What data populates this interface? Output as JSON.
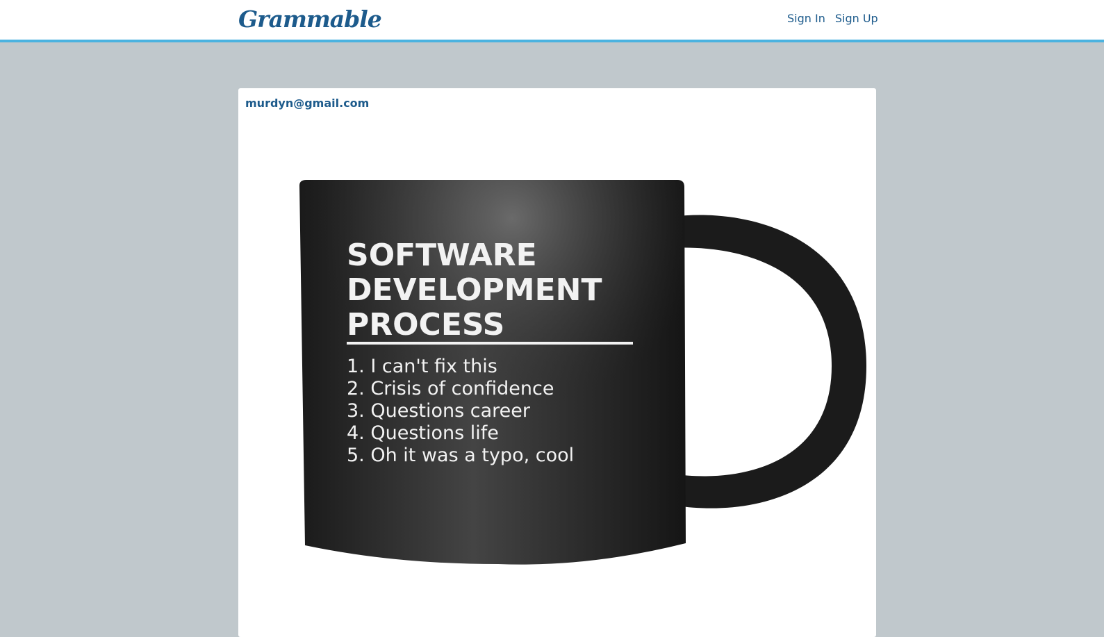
{
  "header": {
    "brand": "Grammable",
    "nav": {
      "sign_in": "Sign In",
      "sign_up": "Sign Up"
    }
  },
  "post": {
    "author": "murdyn@gmail.com",
    "image": {
      "icon": "mug-photo",
      "title_lines": [
        "SOFTWARE",
        "DEVELOPMENT",
        "PROCESS"
      ],
      "list": [
        "1. I can't fix this",
        "2. Crisis of confidence",
        "3. Questions career",
        "4. Questions life",
        "5. Oh it was a typo, cool"
      ]
    }
  },
  "colors": {
    "accent": "#4bb3e0",
    "brand": "#1d5b8c",
    "page_bg": "#c0c8cc"
  }
}
